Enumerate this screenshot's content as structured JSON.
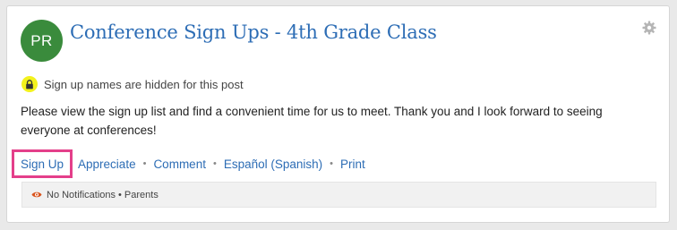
{
  "post": {
    "author_initials": "PR",
    "title": "Conference Sign Ups - 4th Grade Class",
    "privacy_notice": "Sign up names are hidden for this post",
    "message": "Please view the sign up list and find a convenient time for us to meet. Thank you and I look forward to seeing everyone at conferences!"
  },
  "actions": {
    "sign_up": "Sign Up",
    "appreciate": "Appreciate",
    "comment": "Comment",
    "translate": "Español (Spanish)",
    "print": "Print",
    "separator": "•"
  },
  "notifications": {
    "setting": "No Notifications",
    "bullet": "•",
    "audience": "Parents"
  },
  "colors": {
    "avatar_bg": "#3a8b3c",
    "link": "#2d6db5",
    "highlight_border": "#e43f8a",
    "lock_badge": "#f3f21d",
    "eye_icon": "#d9541e"
  },
  "icons": {
    "settings": "gear-icon",
    "privacy": "lock-icon",
    "notifications": "eye-icon"
  }
}
